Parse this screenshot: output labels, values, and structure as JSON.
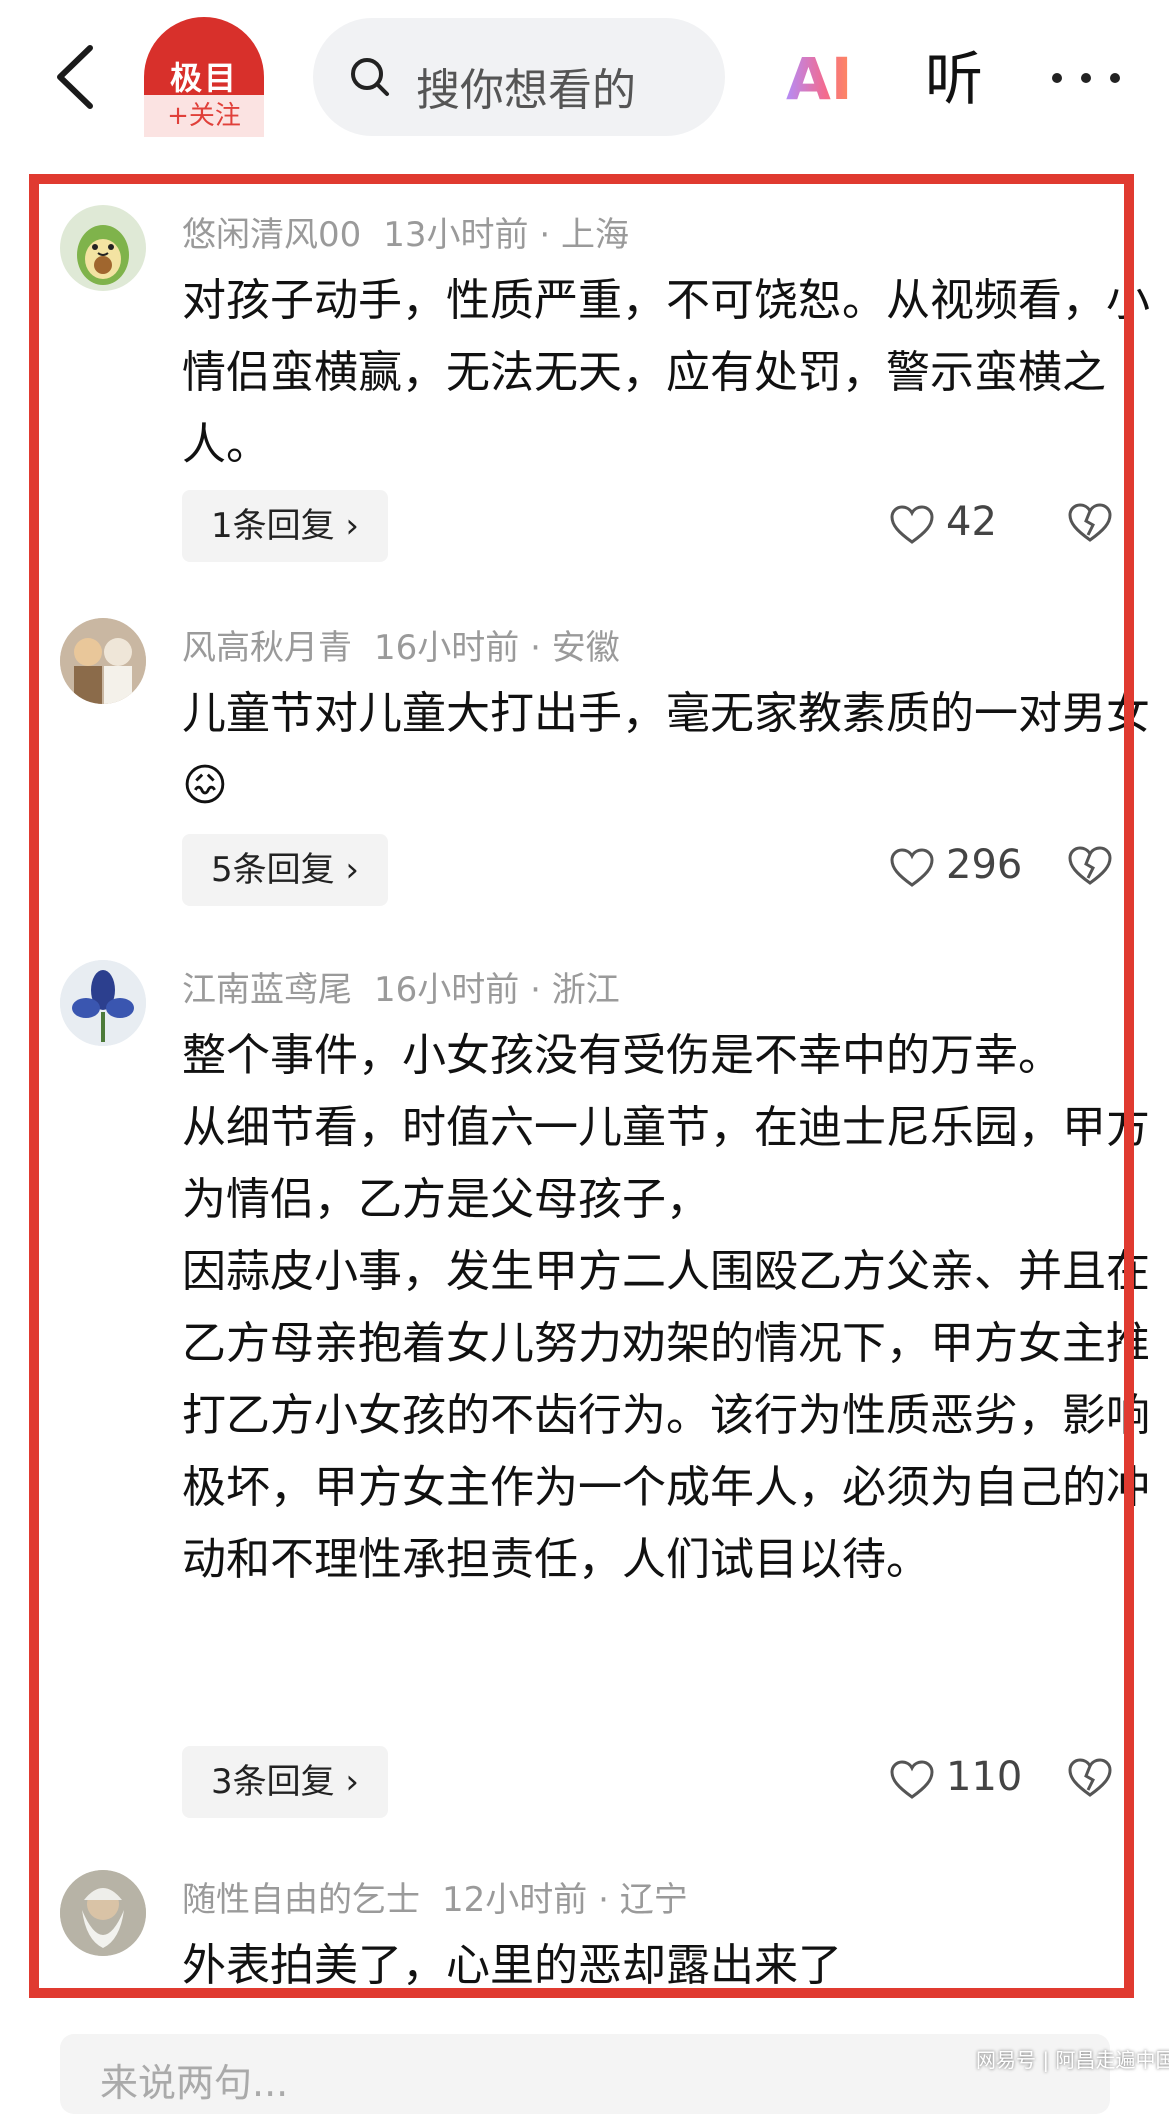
{
  "header": {
    "logo_text": "极目",
    "follow_label": "+关注",
    "search_placeholder": "搜你想看的",
    "ai_label": "AI",
    "listen_label": "听"
  },
  "comments": [
    {
      "name": "悠闲清风00",
      "time": "13小时前",
      "location": "上海",
      "text": [
        "对孩子动手，性质严重，不可饶恕。从视频看，小情侣蛮横赢，无法无天，应有处罚，警示蛮横之人。"
      ],
      "replies": "1条回复 ›",
      "likes": "42"
    },
    {
      "name": "风高秋月青",
      "time": "16小时前",
      "location": "安徽",
      "text": [
        "儿童节对儿童大打出手，毫无家教素质的一对男女😖"
      ],
      "replies": "5条回复 ›",
      "likes": "296"
    },
    {
      "name": "江南蓝鸢尾",
      "time": "16小时前",
      "location": "浙江",
      "text": [
        "整个事件，小女孩没有受伤是不幸中的万幸。",
        "从细节看，时值六一儿童节，在迪士尼乐园，甲方为情侣，乙方是父母孩子，",
        "因蒜皮小事，发生甲方二人围殴乙方父亲、并且在乙方母亲抱着女儿努力劝架的情况下，甲方女主推打乙方小女孩的不齿行为。该行为性质恶劣，影响极坏，甲方女主作为一个成年人，必须为自己的冲动和不理性承担责任，人们试目以待。"
      ],
      "replies": "3条回复 ›",
      "likes": "110"
    },
    {
      "name": "随性自由的乞士",
      "time": "12小时前",
      "location": "辽宁",
      "text": [
        "外表拍美了，心里的恶却露出来了"
      ]
    }
  ],
  "bottom_input_placeholder": "来说两句...",
  "watermark": "网易号 | 阿昌走遍中国",
  "colors": {
    "frame": "#e03a30",
    "brand": "#d8302b"
  }
}
